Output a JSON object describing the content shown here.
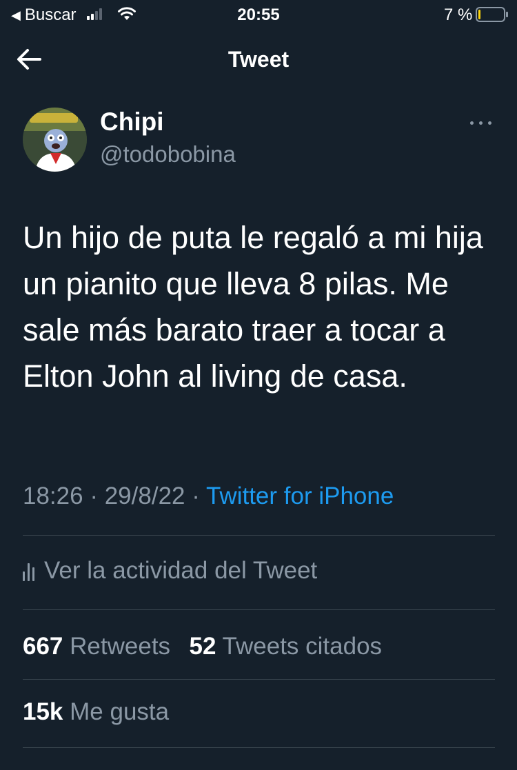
{
  "status_bar": {
    "back_label": "Buscar",
    "time": "20:55",
    "battery_percent": "7 %",
    "battery_level": 0.07
  },
  "header": {
    "title": "Tweet"
  },
  "tweet": {
    "author_name": "Chipi",
    "author_handle": "@todobobina",
    "text": "Un hijo de puta le regaló a mi hija un pianito que lleva 8 pilas. Me sale más barato traer a tocar a Elton John al living de casa.",
    "time": "18:26",
    "separator": "·",
    "date": "29/8/22",
    "source": "Twitter for iPhone",
    "activity_label": "Ver la actividad del Tweet",
    "retweets_count": "667",
    "retweets_label": "Retweets",
    "quotes_count": "52",
    "quotes_label": "Tweets citados",
    "likes_count": "15k",
    "likes_label": "Me gusta"
  },
  "colors": {
    "background": "#15202b",
    "text_primary": "#ffffff",
    "text_secondary": "#8b98a5",
    "accent": "#1d9bf0",
    "divider": "#38444d"
  }
}
